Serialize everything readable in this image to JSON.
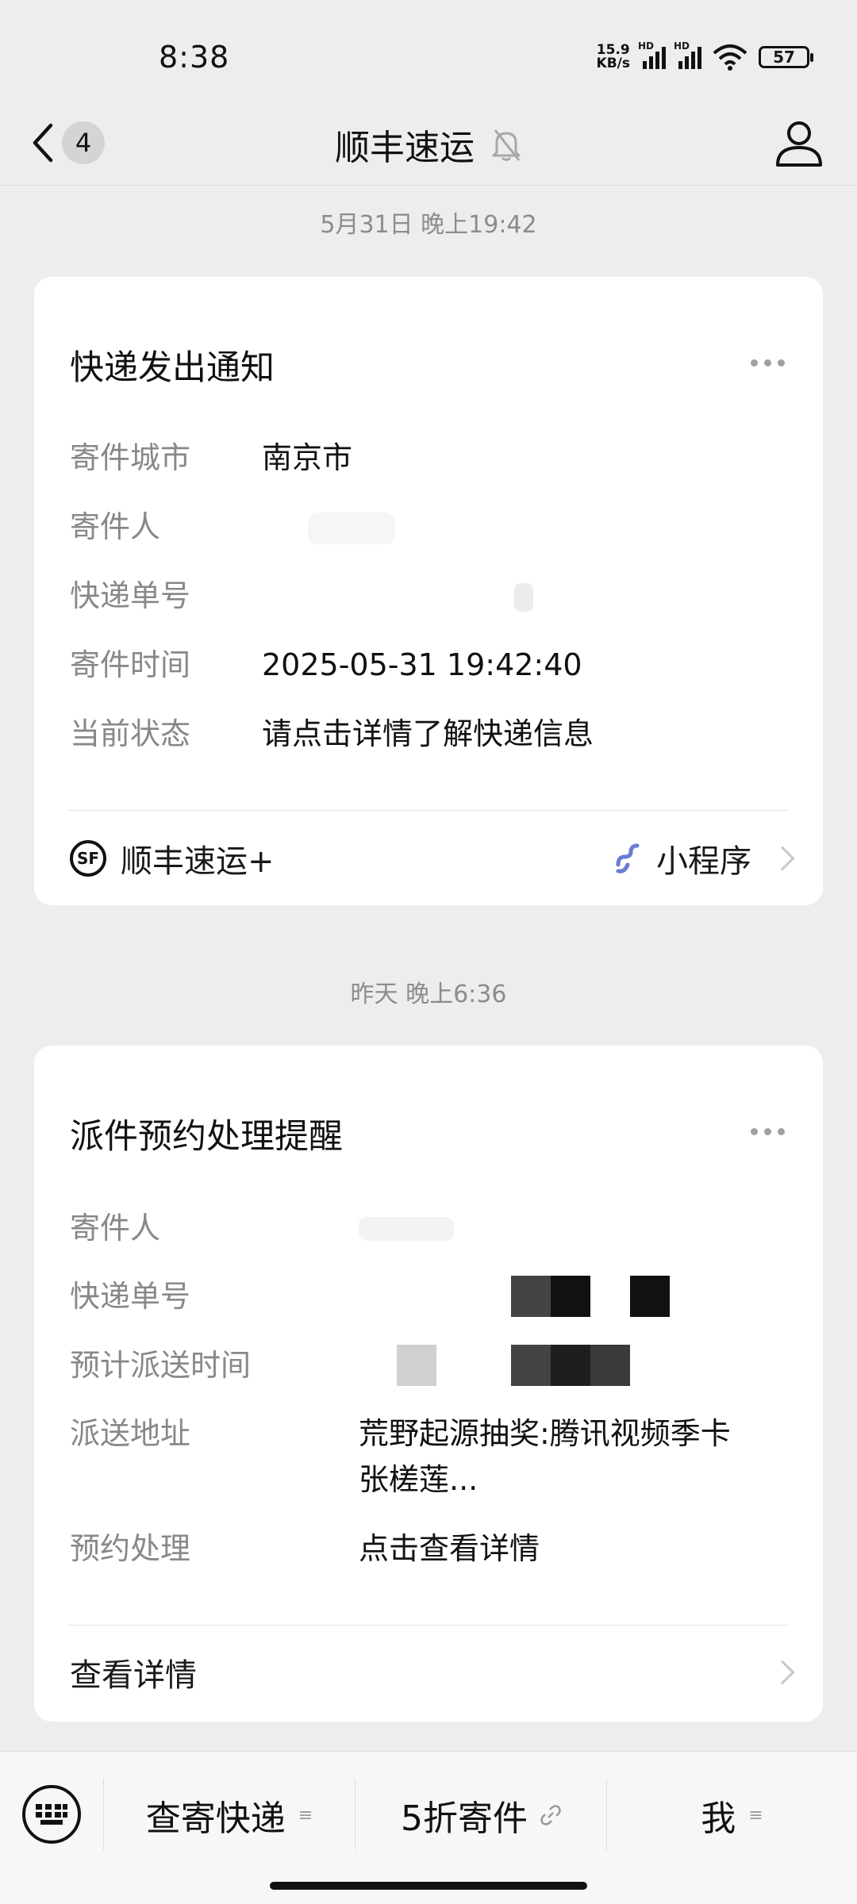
{
  "status_bar": {
    "time": "8:38",
    "net_speed_value": "15.9",
    "net_speed_unit": "KB/s",
    "signal1_label": "HD",
    "signal2_label": "HD",
    "battery": "57"
  },
  "nav": {
    "unread_count": "4",
    "title": "顺丰速运"
  },
  "messages": [
    {
      "timestamp": "5月31日 晚上19:42",
      "card_title": "快递发出通知",
      "rows": [
        {
          "label": "寄件城市",
          "value": "南京市"
        },
        {
          "label": "寄件人",
          "value": ""
        },
        {
          "label": "快递单号",
          "value": ""
        },
        {
          "label": "寄件时间",
          "value": "2025-05-31 19:42:40"
        },
        {
          "label": "当前状态",
          "value": "请点击详情了解快递信息"
        }
      ],
      "footer": {
        "brand": "顺丰速运+",
        "logo_text": "SF",
        "mini_program": "小程序"
      }
    },
    {
      "timestamp": "昨天 晚上6:36",
      "card_title": "派件预约处理提醒",
      "rows": [
        {
          "label": "寄件人",
          "value": ""
        },
        {
          "label": "快递单号",
          "value": ""
        },
        {
          "label": "预计派送时间",
          "value": ""
        },
        {
          "label": "派送地址",
          "value": "荒野起源抽奖:腾讯视频季卡",
          "value_line2": "张槎莲..."
        },
        {
          "label": "预约处理",
          "value": "点击查看详情"
        }
      ],
      "footer": {
        "link": "查看详情"
      }
    }
  ],
  "bottom_menu": {
    "items": [
      {
        "label": "查寄快递",
        "icon": "menu-list-icon"
      },
      {
        "label": "5折寄件",
        "icon": "link-icon"
      },
      {
        "label": "我",
        "icon": "menu-list-icon"
      }
    ]
  }
}
